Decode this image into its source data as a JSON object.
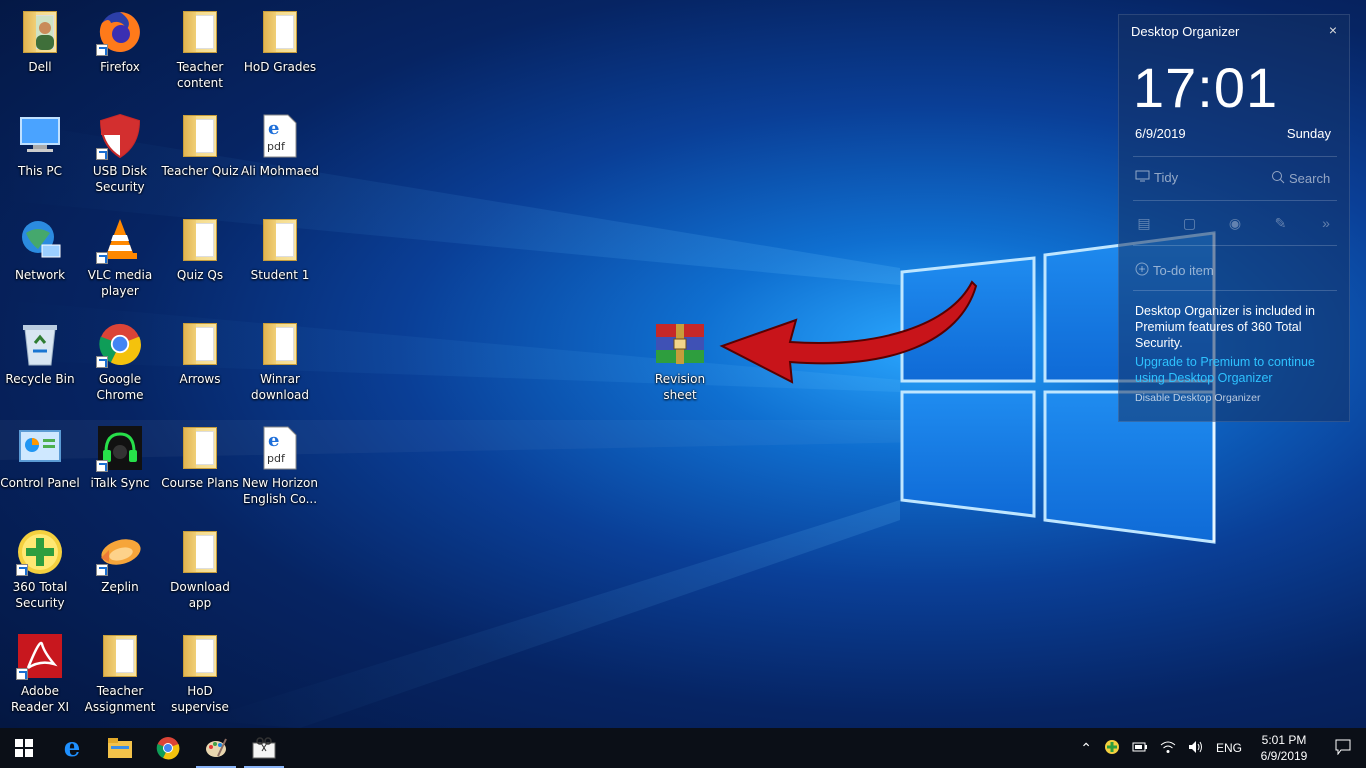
{
  "desktop": {
    "icons": [
      {
        "label": "Dell",
        "icon": "user-folder-icon"
      },
      {
        "label": "Firefox",
        "icon": "firefox-icon"
      },
      {
        "label": "Teacher\ncontent",
        "icon": "folder-icon"
      },
      {
        "label": "HoD Grades",
        "icon": "folder-icon"
      },
      {
        "label": "This PC",
        "icon": "computer-icon"
      },
      {
        "label": "USB Disk\nSecurity",
        "icon": "shield-icon"
      },
      {
        "label": "Teacher Quiz",
        "icon": "folder-icon"
      },
      {
        "label": "Ali Mohmaed",
        "icon": "pdf-icon"
      },
      {
        "label": "Network",
        "icon": "network-icon"
      },
      {
        "label": "VLC media\nplayer",
        "icon": "vlc-icon"
      },
      {
        "label": "Quiz Qs",
        "icon": "folder-icon"
      },
      {
        "label": "Student 1",
        "icon": "folder-icon"
      },
      {
        "label": "Recycle Bin",
        "icon": "recycle-bin-icon"
      },
      {
        "label": "Google\nChrome",
        "icon": "chrome-icon"
      },
      {
        "label": "Arrows",
        "icon": "folder-icon"
      },
      {
        "label": "Winrar\ndownload",
        "icon": "folder-icon"
      },
      {
        "label": "Control Panel",
        "icon": "control-panel-icon"
      },
      {
        "label": "iTalk Sync",
        "icon": "headset-icon"
      },
      {
        "label": "Course Plans",
        "icon": "folder-icon"
      },
      {
        "label": "New Horizon\nEnglish Co...",
        "icon": "pdf-icon"
      },
      {
        "label": "360 Total\nSecurity",
        "icon": "360-security-icon"
      },
      {
        "label": "Zeplin",
        "icon": "zeplin-icon"
      },
      {
        "label": "Download\napp",
        "icon": "folder-icon"
      },
      {
        "label": "Adobe\nReader XI",
        "icon": "adobe-reader-icon"
      },
      {
        "label": "Teacher\nAssignment",
        "icon": "folder-icon"
      },
      {
        "label": "HoD\nsupervise",
        "icon": "folder-icon"
      }
    ],
    "revision_icon": {
      "label": "Revision\nsheet",
      "icon": "winrar-archive-icon"
    }
  },
  "organizer": {
    "title": "Desktop Organizer",
    "close": "×",
    "time": "17:01",
    "date": "6/9/2019",
    "day": "Sunday",
    "tidy_label": "Tidy",
    "search_label": "Search",
    "todo_label": "To-do item",
    "message": "Desktop Organizer is included in Premium features of 360 Total Security.",
    "upgrade_link": "Upgrade to Premium to continue using Desktop Organizer",
    "disable_label": "Disable Desktop Organizer"
  },
  "taskbar": {
    "language": "ENG",
    "clock_time": "5:01 PM",
    "clock_date": "6/9/2019"
  },
  "colors": {
    "taskbar_bg": "#0b0f17",
    "link": "#2ec2ff",
    "arrow": "#c8141a"
  }
}
